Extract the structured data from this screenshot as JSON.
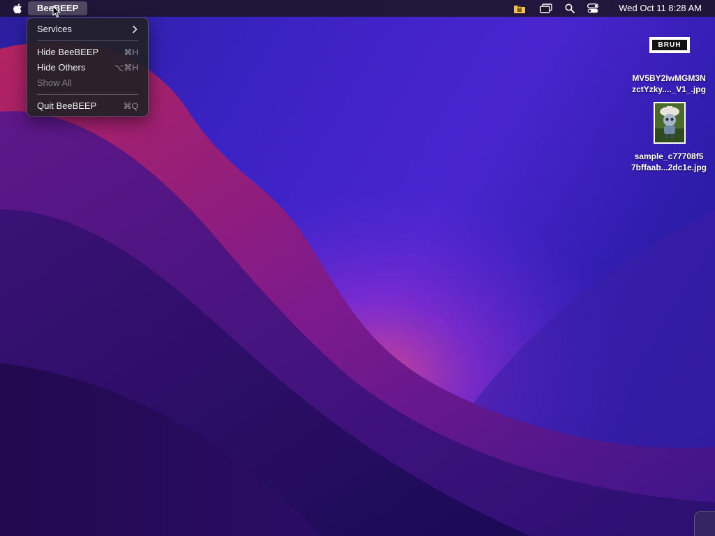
{
  "menubar": {
    "app_name": "BeeBEEP",
    "clock": "Wed Oct 11  8:28 AM",
    "status_icons": [
      "folder-lock-icon",
      "screen-mirroring-icon",
      "search-icon",
      "control-center-icon"
    ]
  },
  "app_menu": {
    "items": [
      {
        "label": "Services",
        "shortcut": "",
        "submenu": true,
        "enabled": true
      },
      {
        "label": "Hide BeeBEEP",
        "shortcut": "⌘H",
        "submenu": false,
        "enabled": true
      },
      {
        "label": "Hide Others",
        "shortcut": "⌥⌘H",
        "submenu": false,
        "enabled": true
      },
      {
        "label": "Show All",
        "shortcut": "",
        "submenu": false,
        "enabled": false
      },
      {
        "label": "Quit BeeBEEP",
        "shortcut": "⌘Q",
        "submenu": false,
        "enabled": true
      }
    ]
  },
  "desktop": {
    "files": [
      {
        "name_line1": "MV5BY2IwMGM3N",
        "name_line2": "zctYzky...._V1_.jpg",
        "thumb_text": "BRUH"
      },
      {
        "name_line1": "sample_c77708f5",
        "name_line2": "7bffaab...2dc1e.jpg"
      }
    ]
  },
  "colors": {
    "wallpaper_base": "#3b22c4",
    "wallpaper_magenta": "#b0205e",
    "menu_bg": "#222028"
  }
}
